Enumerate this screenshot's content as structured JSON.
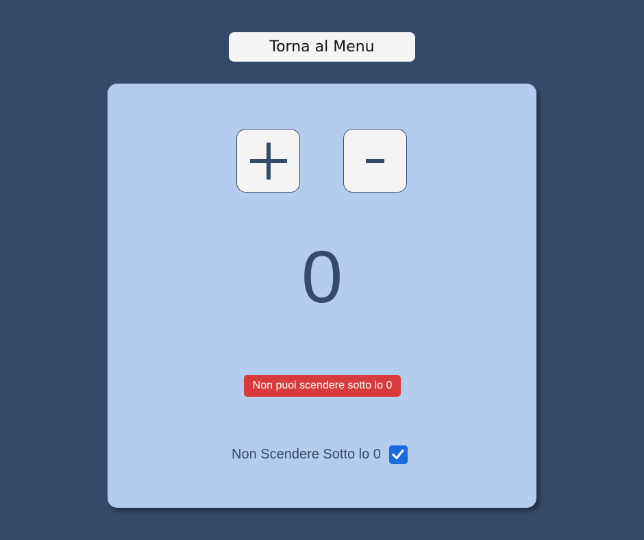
{
  "header": {
    "back_button_label": "Torna al Menu"
  },
  "counter": {
    "increment_label": "+",
    "decrement_label": "-",
    "value": "0"
  },
  "warning": {
    "message": "Non puoi scendere sotto lo 0",
    "color": "#d83b3b"
  },
  "options": {
    "no_negative_label": "Non Scendere Sotto lo 0",
    "no_negative_checked": true,
    "checkbox_color": "#1a6ae0"
  },
  "theme": {
    "background": "#344a68",
    "card": "#b4cced",
    "text": "#344a68"
  }
}
